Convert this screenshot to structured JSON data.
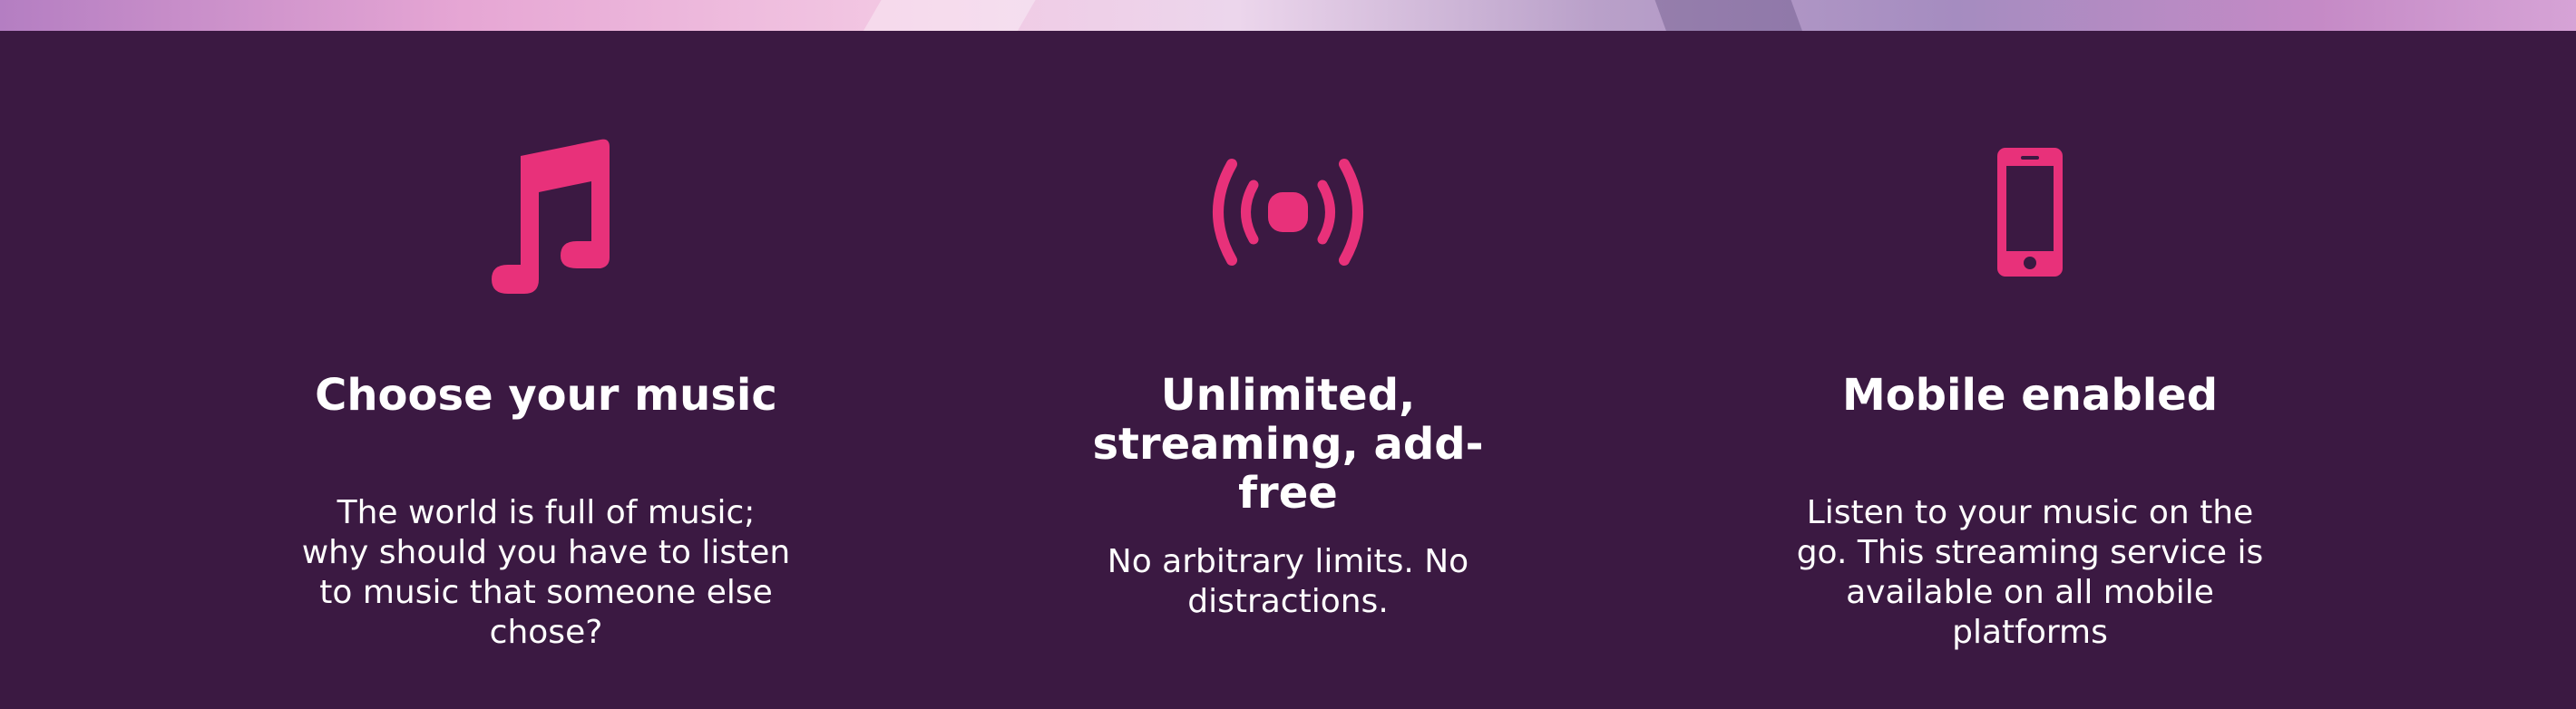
{
  "colors": {
    "background": "#3b1942",
    "accent": "#e8317a",
    "text": "#ffffff"
  },
  "features": [
    {
      "icon": "music-note-icon",
      "title": "Choose your music",
      "description": "The world is full of music; why should you have to listen to music that someone else chose?"
    },
    {
      "icon": "broadcast-icon",
      "title": "Unlimited, streaming, add-free",
      "description": "No arbitrary limits. No distractions."
    },
    {
      "icon": "mobile-phone-icon",
      "title": "Mobile enabled",
      "description": "Listen to your music on the go. This streaming service is available on all mobile platforms"
    }
  ]
}
